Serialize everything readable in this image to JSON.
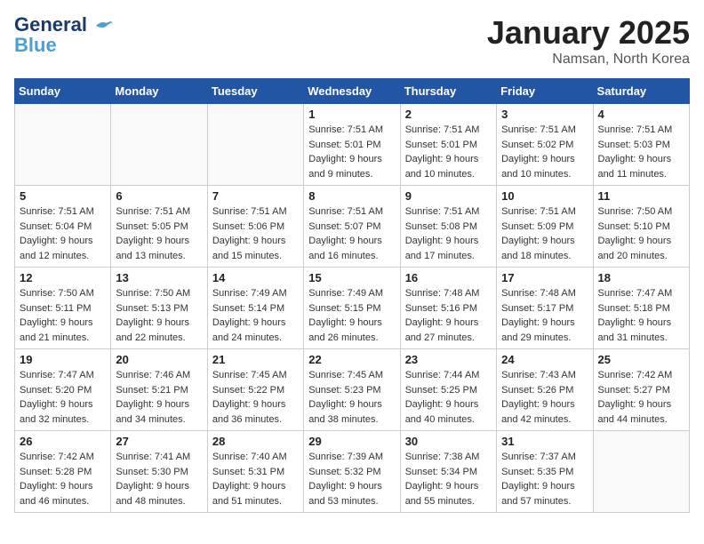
{
  "header": {
    "logo_line1": "General",
    "logo_line2": "Blue",
    "month": "January 2025",
    "location": "Namsan, North Korea"
  },
  "weekdays": [
    "Sunday",
    "Monday",
    "Tuesday",
    "Wednesday",
    "Thursday",
    "Friday",
    "Saturday"
  ],
  "weeks": [
    [
      {
        "day": "",
        "sunrise": "",
        "sunset": "",
        "daylight": ""
      },
      {
        "day": "",
        "sunrise": "",
        "sunset": "",
        "daylight": ""
      },
      {
        "day": "",
        "sunrise": "",
        "sunset": "",
        "daylight": ""
      },
      {
        "day": "1",
        "sunrise": "Sunrise: 7:51 AM",
        "sunset": "Sunset: 5:01 PM",
        "daylight": "Daylight: 9 hours and 9 minutes."
      },
      {
        "day": "2",
        "sunrise": "Sunrise: 7:51 AM",
        "sunset": "Sunset: 5:01 PM",
        "daylight": "Daylight: 9 hours and 10 minutes."
      },
      {
        "day": "3",
        "sunrise": "Sunrise: 7:51 AM",
        "sunset": "Sunset: 5:02 PM",
        "daylight": "Daylight: 9 hours and 10 minutes."
      },
      {
        "day": "4",
        "sunrise": "Sunrise: 7:51 AM",
        "sunset": "Sunset: 5:03 PM",
        "daylight": "Daylight: 9 hours and 11 minutes."
      }
    ],
    [
      {
        "day": "5",
        "sunrise": "Sunrise: 7:51 AM",
        "sunset": "Sunset: 5:04 PM",
        "daylight": "Daylight: 9 hours and 12 minutes."
      },
      {
        "day": "6",
        "sunrise": "Sunrise: 7:51 AM",
        "sunset": "Sunset: 5:05 PM",
        "daylight": "Daylight: 9 hours and 13 minutes."
      },
      {
        "day": "7",
        "sunrise": "Sunrise: 7:51 AM",
        "sunset": "Sunset: 5:06 PM",
        "daylight": "Daylight: 9 hours and 15 minutes."
      },
      {
        "day": "8",
        "sunrise": "Sunrise: 7:51 AM",
        "sunset": "Sunset: 5:07 PM",
        "daylight": "Daylight: 9 hours and 16 minutes."
      },
      {
        "day": "9",
        "sunrise": "Sunrise: 7:51 AM",
        "sunset": "Sunset: 5:08 PM",
        "daylight": "Daylight: 9 hours and 17 minutes."
      },
      {
        "day": "10",
        "sunrise": "Sunrise: 7:51 AM",
        "sunset": "Sunset: 5:09 PM",
        "daylight": "Daylight: 9 hours and 18 minutes."
      },
      {
        "day": "11",
        "sunrise": "Sunrise: 7:50 AM",
        "sunset": "Sunset: 5:10 PM",
        "daylight": "Daylight: 9 hours and 20 minutes."
      }
    ],
    [
      {
        "day": "12",
        "sunrise": "Sunrise: 7:50 AM",
        "sunset": "Sunset: 5:11 PM",
        "daylight": "Daylight: 9 hours and 21 minutes."
      },
      {
        "day": "13",
        "sunrise": "Sunrise: 7:50 AM",
        "sunset": "Sunset: 5:13 PM",
        "daylight": "Daylight: 9 hours and 22 minutes."
      },
      {
        "day": "14",
        "sunrise": "Sunrise: 7:49 AM",
        "sunset": "Sunset: 5:14 PM",
        "daylight": "Daylight: 9 hours and 24 minutes."
      },
      {
        "day": "15",
        "sunrise": "Sunrise: 7:49 AM",
        "sunset": "Sunset: 5:15 PM",
        "daylight": "Daylight: 9 hours and 26 minutes."
      },
      {
        "day": "16",
        "sunrise": "Sunrise: 7:48 AM",
        "sunset": "Sunset: 5:16 PM",
        "daylight": "Daylight: 9 hours and 27 minutes."
      },
      {
        "day": "17",
        "sunrise": "Sunrise: 7:48 AM",
        "sunset": "Sunset: 5:17 PM",
        "daylight": "Daylight: 9 hours and 29 minutes."
      },
      {
        "day": "18",
        "sunrise": "Sunrise: 7:47 AM",
        "sunset": "Sunset: 5:18 PM",
        "daylight": "Daylight: 9 hours and 31 minutes."
      }
    ],
    [
      {
        "day": "19",
        "sunrise": "Sunrise: 7:47 AM",
        "sunset": "Sunset: 5:20 PM",
        "daylight": "Daylight: 9 hours and 32 minutes."
      },
      {
        "day": "20",
        "sunrise": "Sunrise: 7:46 AM",
        "sunset": "Sunset: 5:21 PM",
        "daylight": "Daylight: 9 hours and 34 minutes."
      },
      {
        "day": "21",
        "sunrise": "Sunrise: 7:45 AM",
        "sunset": "Sunset: 5:22 PM",
        "daylight": "Daylight: 9 hours and 36 minutes."
      },
      {
        "day": "22",
        "sunrise": "Sunrise: 7:45 AM",
        "sunset": "Sunset: 5:23 PM",
        "daylight": "Daylight: 9 hours and 38 minutes."
      },
      {
        "day": "23",
        "sunrise": "Sunrise: 7:44 AM",
        "sunset": "Sunset: 5:25 PM",
        "daylight": "Daylight: 9 hours and 40 minutes."
      },
      {
        "day": "24",
        "sunrise": "Sunrise: 7:43 AM",
        "sunset": "Sunset: 5:26 PM",
        "daylight": "Daylight: 9 hours and 42 minutes."
      },
      {
        "day": "25",
        "sunrise": "Sunrise: 7:42 AM",
        "sunset": "Sunset: 5:27 PM",
        "daylight": "Daylight: 9 hours and 44 minutes."
      }
    ],
    [
      {
        "day": "26",
        "sunrise": "Sunrise: 7:42 AM",
        "sunset": "Sunset: 5:28 PM",
        "daylight": "Daylight: 9 hours and 46 minutes."
      },
      {
        "day": "27",
        "sunrise": "Sunrise: 7:41 AM",
        "sunset": "Sunset: 5:30 PM",
        "daylight": "Daylight: 9 hours and 48 minutes."
      },
      {
        "day": "28",
        "sunrise": "Sunrise: 7:40 AM",
        "sunset": "Sunset: 5:31 PM",
        "daylight": "Daylight: 9 hours and 51 minutes."
      },
      {
        "day": "29",
        "sunrise": "Sunrise: 7:39 AM",
        "sunset": "Sunset: 5:32 PM",
        "daylight": "Daylight: 9 hours and 53 minutes."
      },
      {
        "day": "30",
        "sunrise": "Sunrise: 7:38 AM",
        "sunset": "Sunset: 5:34 PM",
        "daylight": "Daylight: 9 hours and 55 minutes."
      },
      {
        "day": "31",
        "sunrise": "Sunrise: 7:37 AM",
        "sunset": "Sunset: 5:35 PM",
        "daylight": "Daylight: 9 hours and 57 minutes."
      },
      {
        "day": "",
        "sunrise": "",
        "sunset": "",
        "daylight": ""
      }
    ]
  ]
}
